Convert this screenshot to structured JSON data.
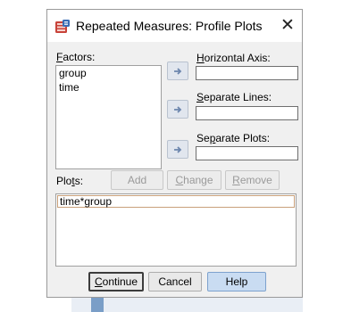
{
  "dialog": {
    "title": "Repeated Measures: Profile Plots",
    "close_symbol": "✕"
  },
  "factors": {
    "label_prefix": "",
    "label_mnemonic": "F",
    "label_rest": "actors:",
    "items": [
      "group",
      "time"
    ]
  },
  "horizontal_axis": {
    "label_mnemonic": "H",
    "label_rest": "orizontal Axis:",
    "value": ""
  },
  "separate_lines": {
    "label_mnemonic": "S",
    "label_rest": "eparate Lines:",
    "value": ""
  },
  "separate_plots": {
    "label_pre": "Se",
    "label_mnemonic": "p",
    "label_rest": "arate Plots:",
    "value": ""
  },
  "plots": {
    "label_pre": "Plo",
    "label_mnemonic": "t",
    "label_rest": "s:",
    "items": [
      "time*group"
    ]
  },
  "buttons": {
    "add": "Add",
    "change_mnemonic": "C",
    "change_rest": "hange",
    "remove_mnemonic": "R",
    "remove_rest": "emove",
    "continue_mnemonic": "C",
    "continue_rest": "ontinue",
    "cancel": "Cancel",
    "help": "Help"
  },
  "colors": {
    "dialog_bg": "#f0f0f0",
    "arrow_button": "#e1e6ee",
    "help_button": "#c9dcf2",
    "icon_red": "#c8433a",
    "icon_blue": "#3a6db5"
  },
  "icons": {
    "app": "spss-table-icon",
    "move": "right-arrow-icon"
  }
}
